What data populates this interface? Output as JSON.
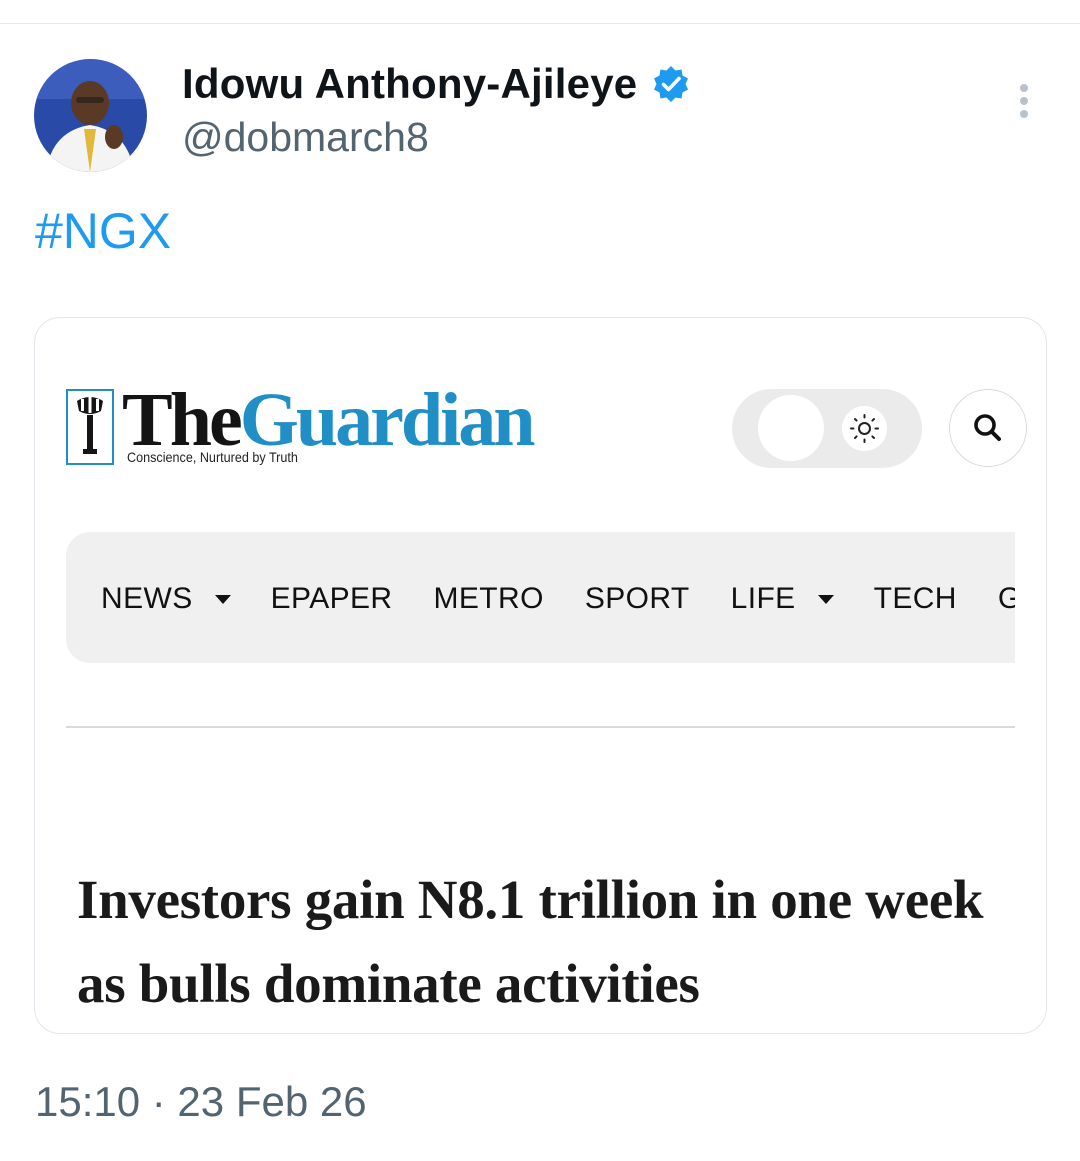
{
  "tweet": {
    "display_name": "Idowu Anthony-Ajileye",
    "handle": "@dobmarch8",
    "hashtag": "#NGX",
    "timestamp": "15:10 · 23 Feb 26"
  },
  "card": {
    "logo_the": "The",
    "logo_guardian": "Guardian",
    "tagline": "Conscience, Nurtured by Truth",
    "nav": [
      {
        "label": "NEWS",
        "has_dropdown": true
      },
      {
        "label": "EPAPER",
        "has_dropdown": false
      },
      {
        "label": "METRO",
        "has_dropdown": false
      },
      {
        "label": "SPORT",
        "has_dropdown": false
      },
      {
        "label": "LIFE",
        "has_dropdown": true
      },
      {
        "label": "TECH",
        "has_dropdown": false
      },
      {
        "label": "GTV",
        "has_dropdown": false
      }
    ],
    "headline": "Investors gain N8.1 trillion in one week as bulls dominate activities"
  },
  "colors": {
    "link": "#1d9bf0",
    "guardian_blue": "#1f8fc6",
    "verified": "#1d9bf0",
    "secondary_text": "#536471"
  }
}
